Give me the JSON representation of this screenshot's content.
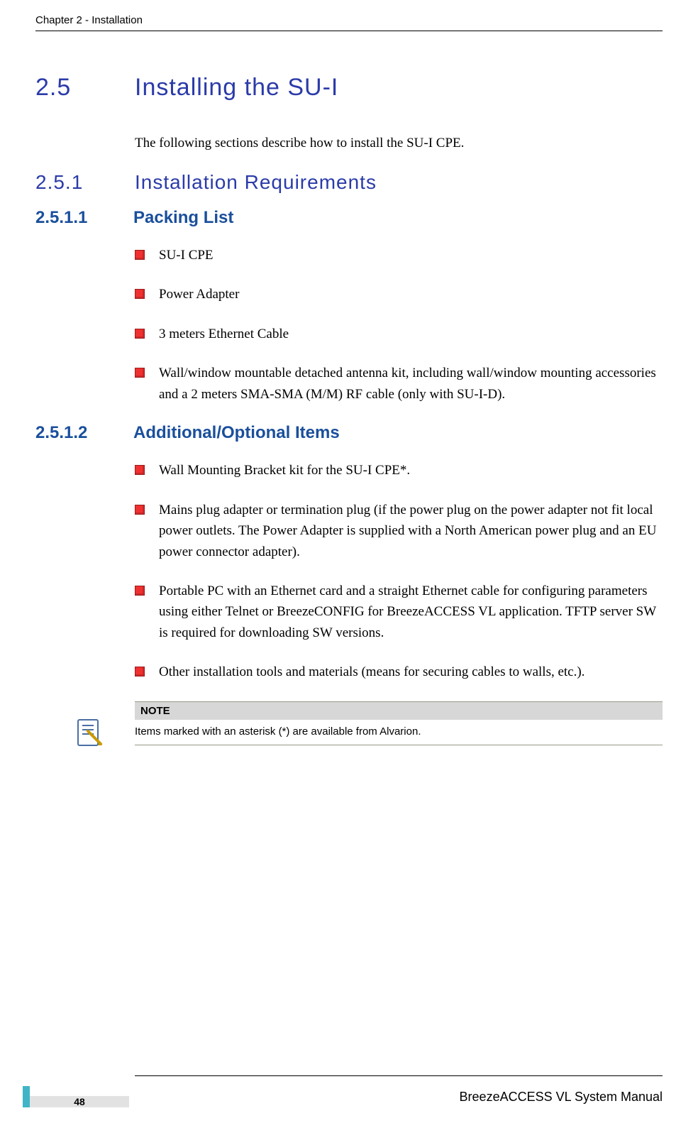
{
  "header": {
    "text": "Chapter 2 - Installation"
  },
  "h1": {
    "num": "2.5",
    "title": "Installing the SU-I"
  },
  "intro": "The following sections describe how to install the SU-I CPE.",
  "h2": {
    "num": "2.5.1",
    "title": "Installation Requirements"
  },
  "sections": {
    "s1": {
      "num": "2.5.1.1",
      "title": "Packing List",
      "items": [
        "SU-I CPE",
        "Power Adapter",
        "3 meters Ethernet Cable",
        "Wall/window mountable detached antenna kit, including wall/window mounting accessories and a 2 meters SMA-SMA (M/M) RF cable (only with SU-I-D)."
      ]
    },
    "s2": {
      "num": "2.5.1.2",
      "title": "Additional/Optional Items",
      "items": [
        "Wall Mounting Bracket kit for the SU-I CPE*.",
        "Mains plug adapter or termination plug (if the power plug on the power adapter not fit local power outlets. The Power Adapter is supplied with a North American power plug and an EU power connector adapter).",
        "Portable PC with an Ethernet card and a straight Ethernet cable for configuring parameters using either Telnet or BreezeCONFIG for BreezeACCESS VL application. TFTP server SW is required for downloading SW versions.",
        "Other installation tools and materials (means for securing cables to walls, etc.)."
      ]
    }
  },
  "note": {
    "label": "NOTE",
    "text": "Items marked with an asterisk (*) are available from Alvarion."
  },
  "footer": {
    "page": "48",
    "manual": "BreezeACCESS VL System Manual"
  }
}
